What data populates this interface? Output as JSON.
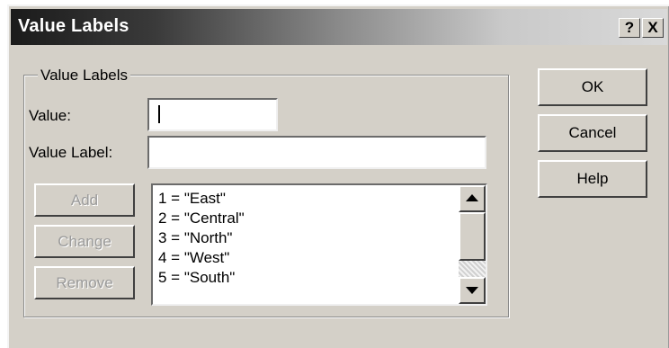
{
  "window": {
    "title": "Value Labels",
    "help_button": "?",
    "close_button": "X"
  },
  "group": {
    "label": "Value Labels"
  },
  "fields": {
    "value_label": "Value:",
    "value_value": "",
    "value_label_label": "Value Label:",
    "value_label_value": ""
  },
  "buttons": {
    "add": "Add",
    "change": "Change",
    "remove": "Remove",
    "ok": "OK",
    "cancel": "Cancel",
    "help": "Help"
  },
  "list": {
    "items": [
      "1 = \"East\"",
      "2 = \"Central\"",
      "3 = \"North\"",
      "4 = \"West\"",
      "5 = \"South\""
    ]
  }
}
